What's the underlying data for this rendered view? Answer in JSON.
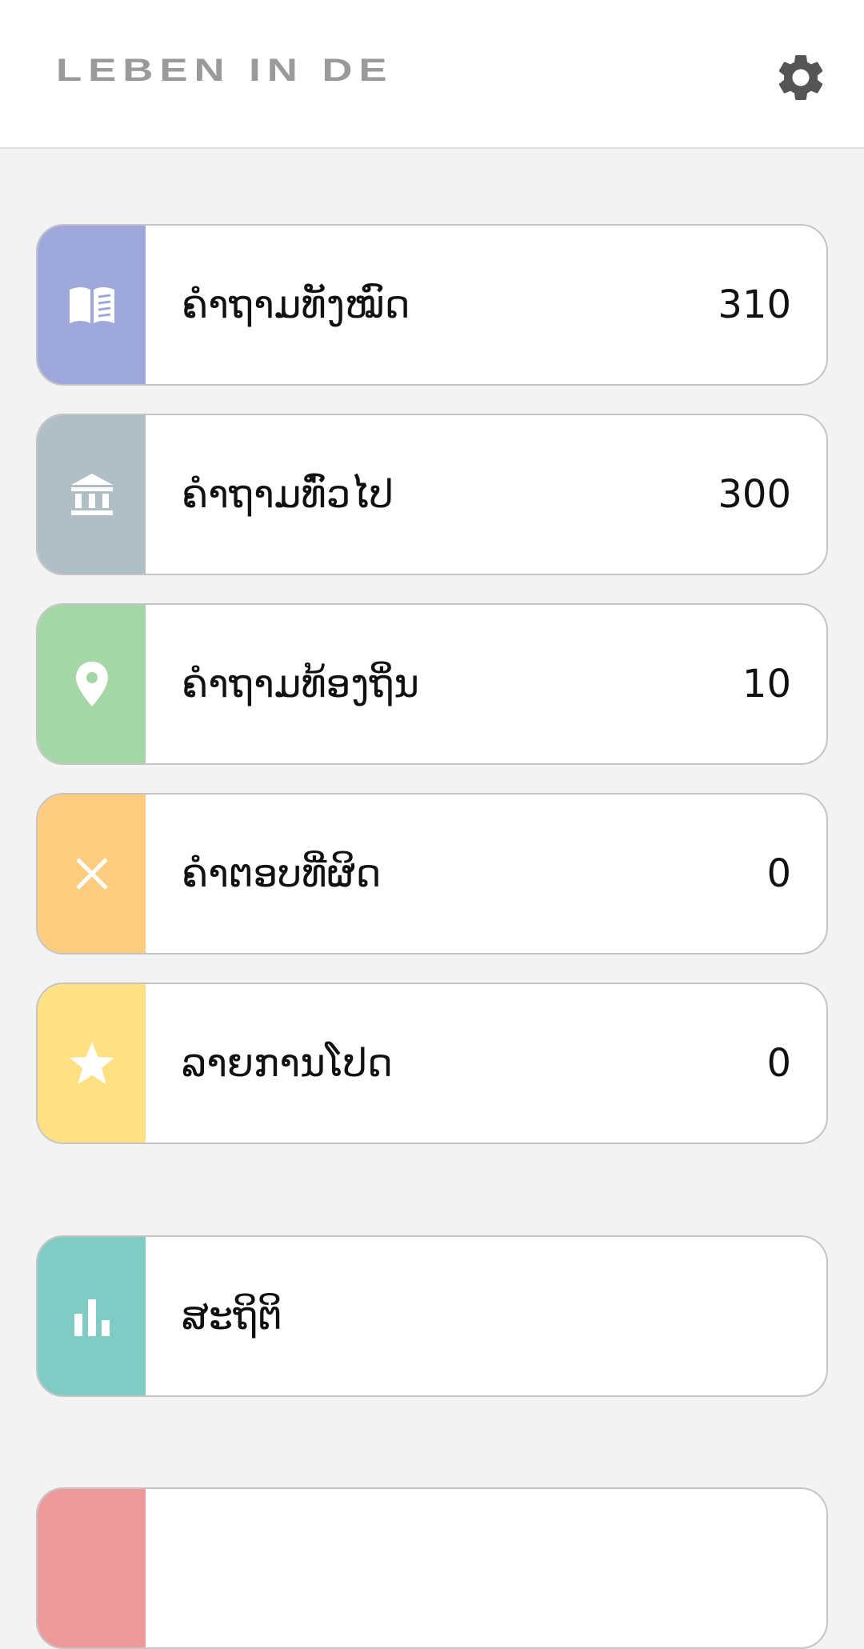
{
  "header": {
    "title": "LEBEN IN DE",
    "settings_icon": "gear-icon"
  },
  "menu": [
    {
      "label": "ຄຳຖາມທັງໝົດ",
      "count": "310",
      "icon": "book-icon",
      "color": "#9fa8da"
    },
    {
      "label": "ຄຳຖາມທົ່ວໄປ",
      "count": "300",
      "icon": "bank-icon",
      "color": "#b0bec5"
    },
    {
      "label": "ຄຳຖາມທ້ອງຖິ່ນ",
      "count": "10",
      "icon": "location-pin-icon",
      "color": "#a5d6a7"
    },
    {
      "label": "ຄຳຕອບທີ່ຜິດ",
      "count": "0",
      "icon": "close-icon",
      "color": "#ffcc80"
    },
    {
      "label": "ລາຍການໂປດ",
      "count": "0",
      "icon": "star-icon",
      "color": "#ffe082"
    }
  ],
  "statistics": {
    "label": "ສະຖິຕິ",
    "icon": "bar-chart-icon",
    "color": "#80cbc4"
  },
  "partial_card": {
    "color": "#ef9a9a"
  }
}
